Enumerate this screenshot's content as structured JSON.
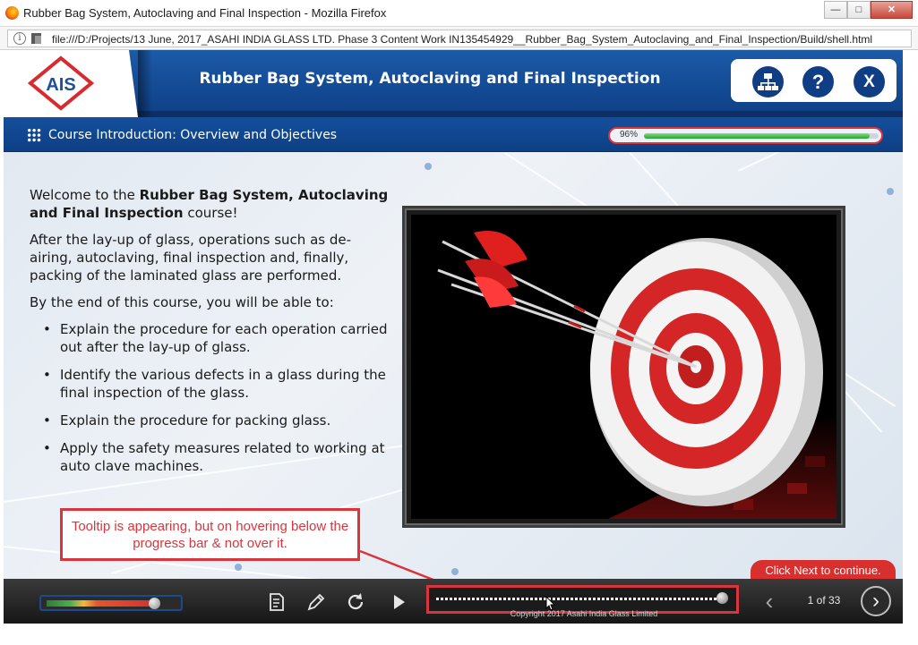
{
  "browser": {
    "window_title": "Rubber Bag System, Autoclaving and Final Inspection - Mozilla Firefox",
    "min_label": "—",
    "max_label": "□",
    "close_label": "✕",
    "info_label": "i",
    "url": "file:///D:/Projects/13 June, 2017_ASAHI INDIA GLASS LTD. Phase 3 Content Work IN135454929__Rubber_Bag_System_Autoclaving_and_Final_Inspection/Build/shell.html"
  },
  "header": {
    "logo_text": "AIS",
    "course_title": "Rubber Bag System, Autoclaving and Final Inspection",
    "help_label": "?",
    "exit_label": "X"
  },
  "subheader": {
    "module_title": "Course Introduction: Overview and Objectives",
    "progress_text": "96%",
    "progress_value": 0.96
  },
  "content": {
    "welcome_prefix": "Welcome to the ",
    "welcome_bold": "Rubber Bag System, Autoclaving and Final Inspection",
    "welcome_suffix": " course!",
    "intro": "After the lay-up of glass, operations such as de-airing, autoclaving, final inspection and, finally, packing of the laminated glass are performed.",
    "objectives_lead": "By the end of this course, you will be able to:",
    "objectives": [
      "Explain the procedure for each operation carried out after the lay-up of glass.",
      "Identify the various defects in a glass during the final inspection of the glass.",
      "Explain the procedure for packing glass.",
      "Apply the safety measures related to working at auto clave machines."
    ]
  },
  "annotation": {
    "tooltip_note": "Tooltip is appearing, but on hovering below the progress bar & not over it."
  },
  "footer": {
    "next_hint": "Click Next to continue.",
    "copyright": "Copyright 2017 Asahi India Glass Limited",
    "page_count": "1 of 33",
    "volume_level": 0.9,
    "seek_value": 0.98,
    "prev_label": "‹",
    "next_label": "›"
  },
  "colors": {
    "brand_blue": "#0f3e84",
    "accent_red": "#d9353d",
    "progress_green": "#27a334"
  },
  "icons": [
    "firefox-icon",
    "info-icon",
    "page-icon",
    "sitemap-icon",
    "help-icon",
    "exit-icon",
    "grid-menu-icon",
    "notes-icon",
    "pencil-icon",
    "replay-icon",
    "play-icon",
    "prev-icon",
    "next-icon",
    "mouse-cursor-icon"
  ]
}
